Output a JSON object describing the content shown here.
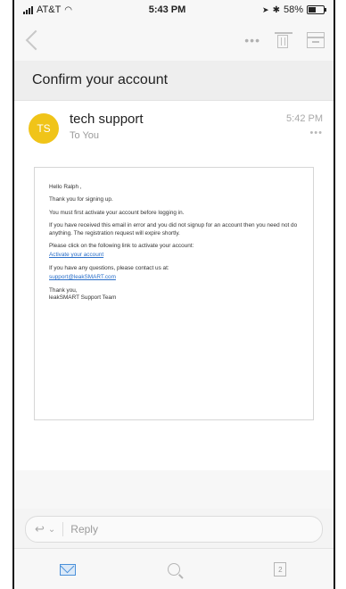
{
  "status_bar": {
    "carrier": "AT&T",
    "time": "5:43 PM",
    "battery": "58%",
    "battery_level": 0.58
  },
  "nav": {
    "more_label": "•••"
  },
  "subject": "Confirm your account",
  "message": {
    "avatar_initials": "TS",
    "avatar_color": "#f0c419",
    "sender": "tech support",
    "recipient": "To You",
    "time": "5:42 PM",
    "more_label": "•••"
  },
  "email_body": {
    "greeting": "Hello Ralph ,",
    "line1": "Thank you for signing up.",
    "line2": "You must first activate your account before logging in.",
    "line3": "If you have received this email in error and you did not signup for an account then you need not do anything. The registration request will expire shortly.",
    "line4": "Please click on the following link to activate your account:",
    "activate_link": "Activate your account",
    "line5": "If you have any questions, please contact us at:",
    "support_email": "support@leakSMART.com",
    "signoff": "Thank you,",
    "team": "leakSMART Support Team"
  },
  "reply": {
    "label": "Reply"
  },
  "tabs": {
    "calendar_day": "2"
  },
  "colors": {
    "accent": "#4a90d9",
    "link": "#2a6fc9"
  }
}
